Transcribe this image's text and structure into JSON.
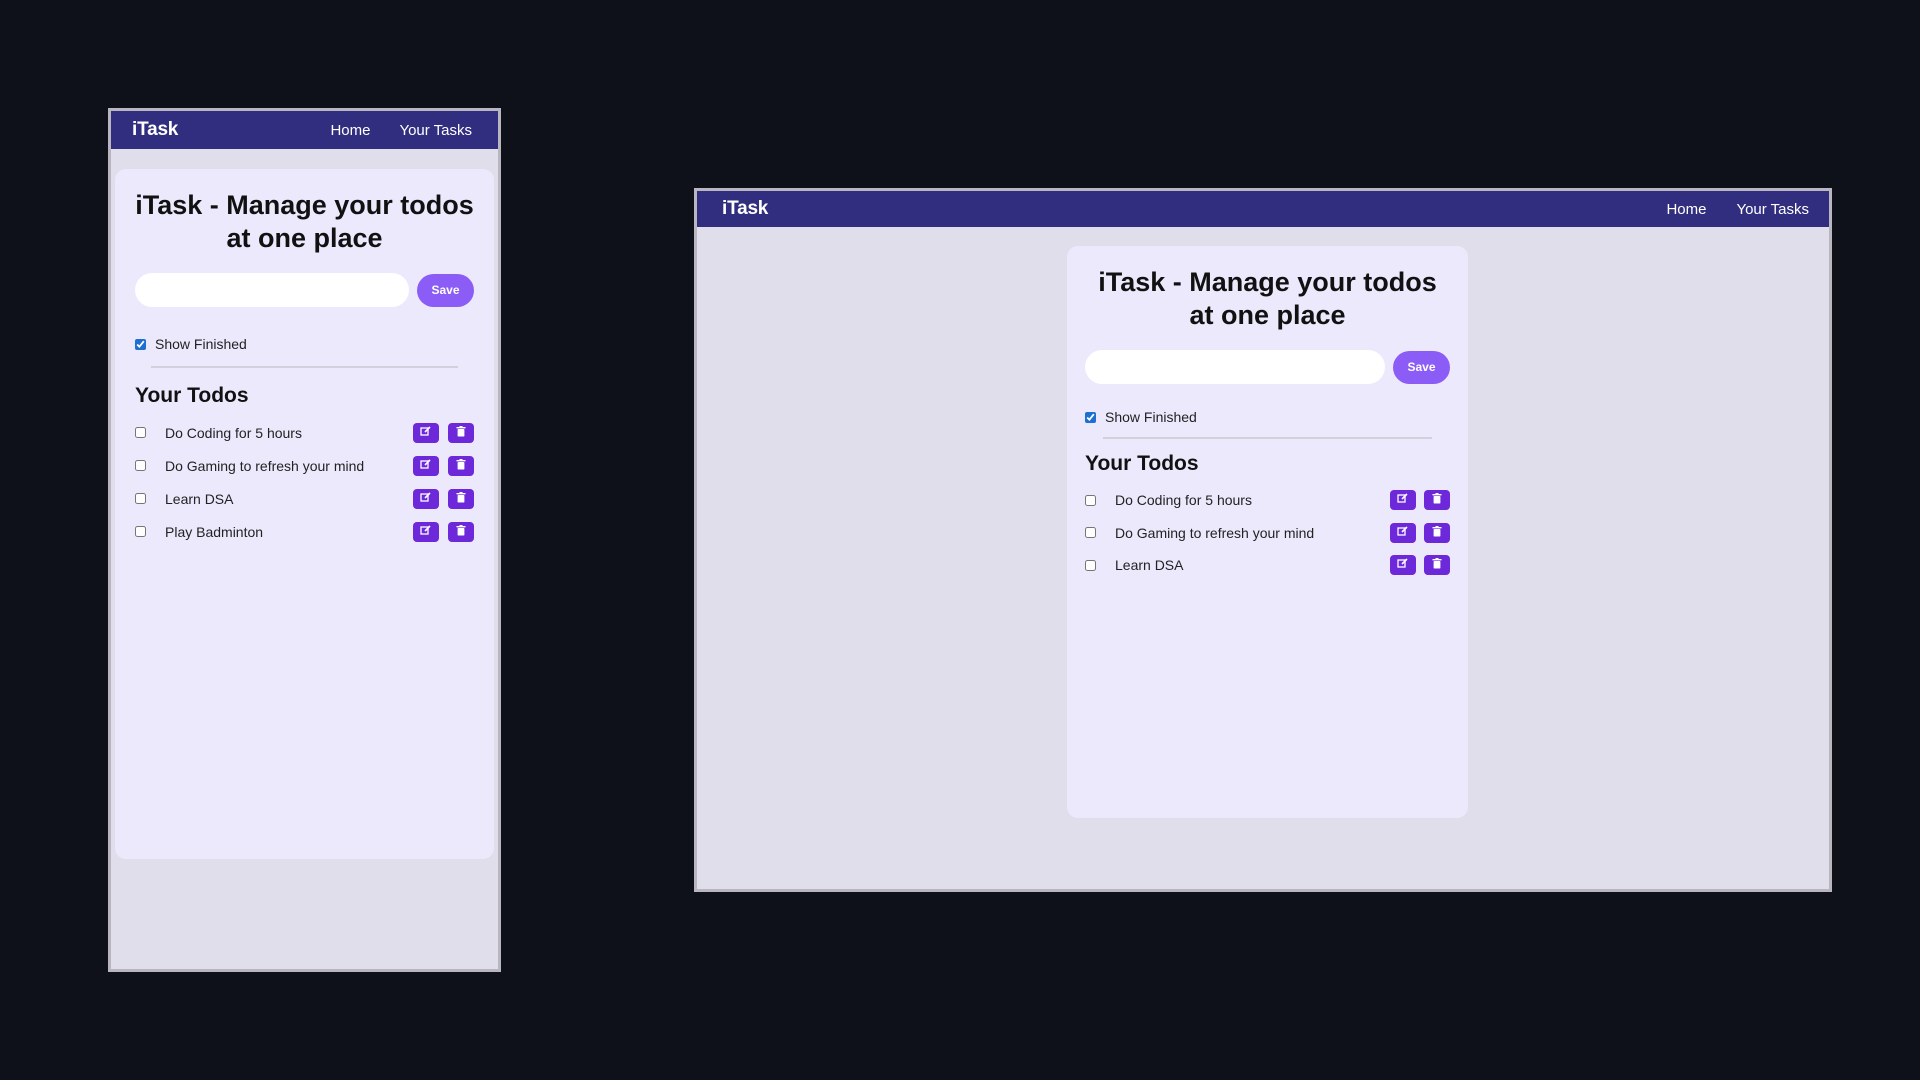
{
  "colors": {
    "background": "#0e111a",
    "navbar": "#312d7f",
    "page": "#e0deeb",
    "card": "#ede9fd",
    "save_button": "#8b5cf6",
    "action_button": "#6d28d9"
  },
  "navbar": {
    "logo": "iTask",
    "links": [
      "Home",
      "Your Tasks"
    ]
  },
  "main": {
    "title": "iTask - Manage your todos at one place",
    "input_value": "",
    "save_label": "Save",
    "show_finished_label": "Show Finished",
    "show_finished_checked": true,
    "todos_heading": "Your Todos"
  },
  "mobile_view": {
    "todos": [
      {
        "text": "Do Coding for 5 hours",
        "done": false
      },
      {
        "text": "Do Gaming to refresh your mind",
        "done": false
      },
      {
        "text": "Learn DSA",
        "done": false
      },
      {
        "text": "Play Badminton",
        "done": false
      }
    ]
  },
  "desktop_view": {
    "todos": [
      {
        "text": "Do Coding for 5 hours",
        "done": false
      },
      {
        "text": "Do Gaming to refresh your mind",
        "done": false
      },
      {
        "text": "Learn DSA",
        "done": false
      }
    ]
  },
  "icons": {
    "edit": "edit-icon",
    "delete": "delete-icon"
  }
}
